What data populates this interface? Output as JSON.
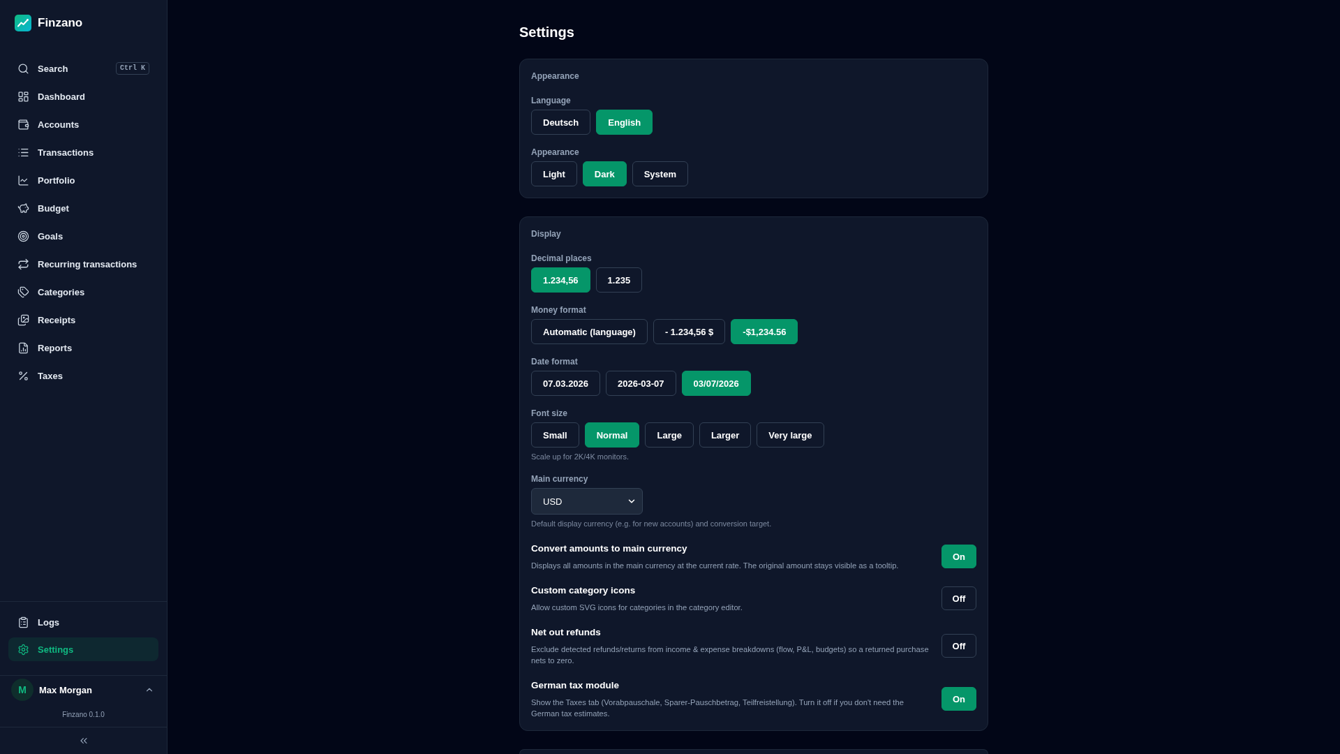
{
  "app": {
    "name": "Finzano"
  },
  "sidebar": {
    "search": {
      "label": "Search",
      "shortcut": "Ctrl K"
    },
    "items": [
      {
        "label": "Dashboard",
        "selected": false
      },
      {
        "label": "Accounts",
        "selected": false
      },
      {
        "label": "Transactions",
        "selected": false
      },
      {
        "label": "Portfolio",
        "selected": false
      },
      {
        "label": "Budget",
        "selected": false
      },
      {
        "label": "Goals",
        "selected": false
      },
      {
        "label": "Recurring transactions",
        "selected": false
      },
      {
        "label": "Categories",
        "selected": false
      },
      {
        "label": "Receipts",
        "selected": false
      },
      {
        "label": "Reports",
        "selected": false
      },
      {
        "label": "Taxes",
        "selected": false
      }
    ],
    "footer_items": [
      {
        "label": "Logs",
        "selected": false
      },
      {
        "label": "Settings",
        "selected": true
      }
    ],
    "user": {
      "initial": "M",
      "name": "Max Morgan"
    },
    "version": "Finzano 0.1.0"
  },
  "page": {
    "title": "Settings"
  },
  "sections": [
    {
      "heading": "Appearance",
      "groups": [
        {
          "label": "Language",
          "options": [
            {
              "label": "Deutsch",
              "selected": false
            },
            {
              "label": "English",
              "selected": true
            }
          ]
        },
        {
          "label": "Appearance",
          "options": [
            {
              "label": "Light",
              "selected": false
            },
            {
              "label": "Dark",
              "selected": true
            },
            {
              "label": "System",
              "selected": false
            }
          ]
        }
      ]
    },
    {
      "heading": "Display",
      "groups": [
        {
          "label": "Decimal places",
          "options": [
            {
              "label": "1.234,56",
              "selected": true
            },
            {
              "label": "1.235",
              "selected": false
            }
          ]
        },
        {
          "label": "Money format",
          "options": [
            {
              "label": "Automatic (language)",
              "selected": false
            },
            {
              "label": "- 1.234,56 $",
              "selected": false
            },
            {
              "label": "-$1,234.56",
              "selected": true
            }
          ]
        },
        {
          "label": "Date format",
          "options": [
            {
              "label": "07.03.2026",
              "selected": false
            },
            {
              "label": "2026-03-07",
              "selected": false
            },
            {
              "label": "03/07/2026",
              "selected": true
            }
          ]
        },
        {
          "label": "Font size",
          "options": [
            {
              "label": "Small",
              "selected": false
            },
            {
              "label": "Normal",
              "selected": true
            },
            {
              "label": "Large",
              "selected": false
            },
            {
              "label": "Larger",
              "selected": false
            },
            {
              "label": "Very large",
              "selected": false
            }
          ],
          "hint": "Scale up for 2K/4K monitors."
        }
      ],
      "currency": {
        "label": "Main currency",
        "value": "USD",
        "hint": "Default display currency (e.g. for new accounts) and conversion target."
      },
      "toggles": [
        {
          "title": "Convert amounts to main currency",
          "description": "Displays all amounts in the main currency at the current rate. The original amount stays visible as a tooltip.",
          "on": true,
          "state_label": "On"
        },
        {
          "title": "Custom category icons",
          "description": "Allow custom SVG icons for categories in the category editor.",
          "on": false,
          "state_label": "Off"
        },
        {
          "title": "Net out refunds",
          "description": "Exclude detected refunds/returns from income & expense breakdowns (flow, P&L, budgets) so a returned purchase nets to zero.",
          "on": false,
          "state_label": "Off"
        },
        {
          "title": "German tax module",
          "description": "Show the Taxes tab (Vorabpauschale, Sparer-Pauschbetrag, Teilfreistellung). Turn it off if you don't need the German tax estimates.",
          "on": true,
          "state_label": "On"
        }
      ]
    }
  ]
}
